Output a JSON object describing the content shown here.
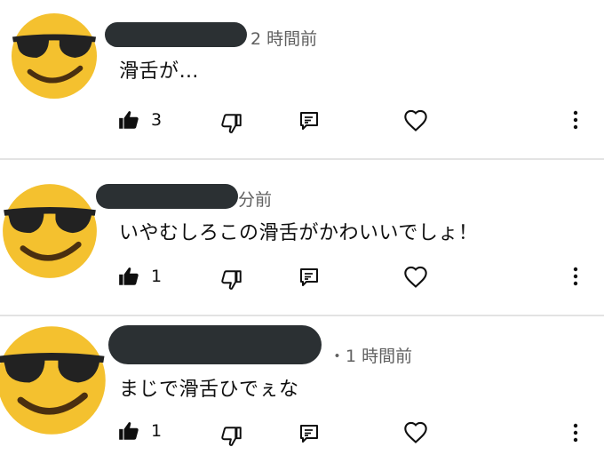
{
  "comments": [
    {
      "meta": "2 時間前",
      "text": "滑舌が…",
      "like_count": "3"
    },
    {
      "meta": "分前",
      "text": "いやむしろこの滑舌がかわいいでしょ！",
      "like_count": "1"
    },
    {
      "meta": "・1 時間前",
      "text": "まじで滑舌ひでぇな",
      "like_count": "1"
    }
  ],
  "icons": {
    "avatar": "sunglasses-emoji-avatar",
    "like": "thumbs-up-icon",
    "dislike": "thumbs-down-icon",
    "reply": "reply-icon",
    "heart": "heart-icon",
    "more": "more-vertical-icon"
  },
  "colors": {
    "emoji_face": "#f4c12f",
    "redaction": "#2b3033",
    "meta_text": "#606060",
    "divider": "#e3e3e3"
  }
}
